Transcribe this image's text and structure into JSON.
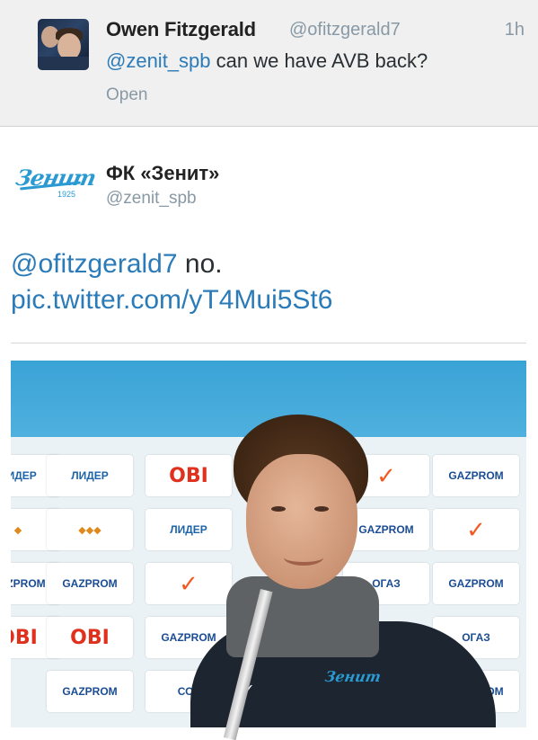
{
  "reply_tweet": {
    "display_name": "Owen Fitzgerald",
    "screen_name": "@ofitzgerald7",
    "timestamp": "1h",
    "mention": "@zenit_spb",
    "text": " can we have AVB back?",
    "open_label": "Open",
    "avatar_icon": "user-avatar-photo"
  },
  "main_tweet": {
    "display_name": "ФК «Зенит»",
    "screen_name": "@zenit_spb",
    "avatar_icon": "zenit-logo",
    "logo_word": "Зенит",
    "logo_year": "1925",
    "mention": "@ofitzgerald7",
    "text": " no.",
    "link": "pic.twitter.com/yT4Mui5St6"
  },
  "photo": {
    "description_icon": "press-conference-photo",
    "sponsor_logos": [
      "ЛИДЕР",
      "OBI",
      "GAZPROM",
      "ЛИДЕР",
      "OBI",
      "GAZPROM",
      "ОГАЗ",
      "СОГ"
    ],
    "jacket_badge": "Зенит",
    "colors": {
      "sky": "#53b3e0",
      "board": "#eaf2f6",
      "jacket": "#1c2530",
      "zenit_blue": "#2b9ad3",
      "obi_red": "#e0301e",
      "nike_orange": "#f15a22"
    }
  },
  "colors": {
    "link": "#2b7bb9",
    "muted": "#8899a6",
    "reply_bg": "#f0f0f0"
  }
}
